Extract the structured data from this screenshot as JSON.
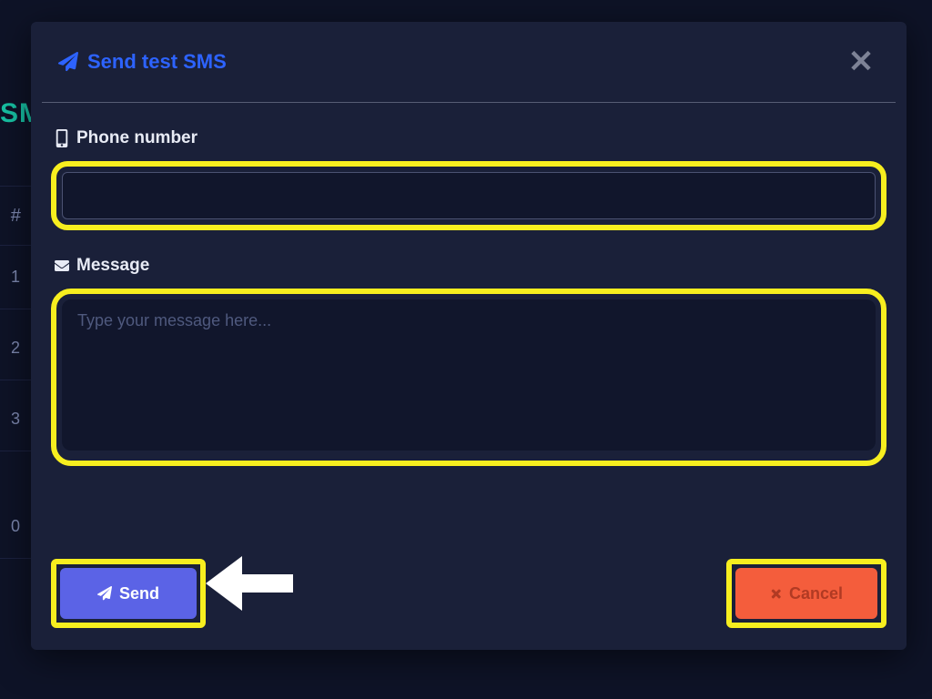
{
  "background": {
    "title_fragment": "SM",
    "header_symbol": "#",
    "row_numbers": [
      "1",
      "2",
      "3",
      "0"
    ]
  },
  "modal": {
    "title": "Send test SMS",
    "close_glyph": "✕",
    "fields": {
      "phone_label": "Phone number",
      "phone_value": "",
      "message_label": "Message",
      "message_placeholder": "Type your message here...",
      "message_value": ""
    },
    "buttons": {
      "send": "Send",
      "cancel": "Cancel"
    }
  },
  "colors": {
    "accent_blue": "#2d63ff",
    "highlight_yellow": "#f7ee1f",
    "send_bg": "#5b63e6",
    "cancel_bg": "#f45d3c",
    "panel_bg": "#1a2039",
    "page_bg": "#0e1327"
  }
}
